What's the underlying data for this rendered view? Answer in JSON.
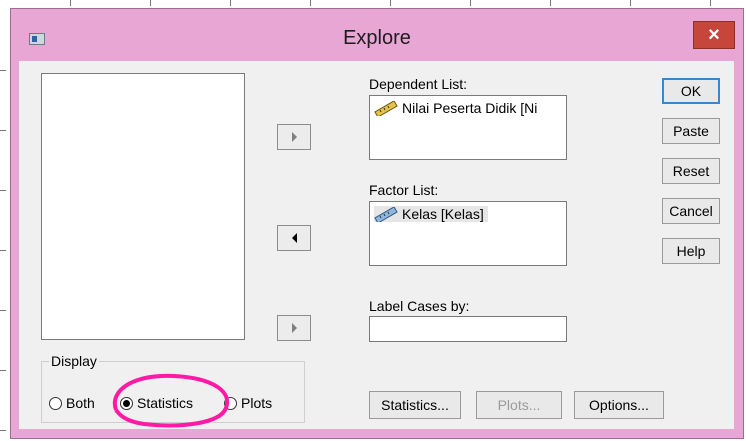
{
  "window": {
    "title": "Explore",
    "close_label": "×"
  },
  "dependent": {
    "label": "Dependent List:",
    "items": [
      "Nilai Peserta Didik  [Ni"
    ]
  },
  "factor": {
    "label": "Factor List:",
    "items": [
      "Kelas  [Kelas]"
    ]
  },
  "label_cases": {
    "label": "Label Cases by:",
    "value": ""
  },
  "buttons": {
    "ok": "OK",
    "paste": "Paste",
    "reset": "Reset",
    "cancel": "Cancel",
    "help": "Help",
    "statistics": "Statistics...",
    "plots": "Plots...",
    "options": "Options..."
  },
  "display": {
    "title": "Display",
    "options": [
      "Both",
      "Statistics",
      "Plots"
    ],
    "selected": "Statistics"
  },
  "colors": {
    "window_bg": "#e7a6d4",
    "close": "#c7463b",
    "annotation": "#ff1aa6"
  }
}
